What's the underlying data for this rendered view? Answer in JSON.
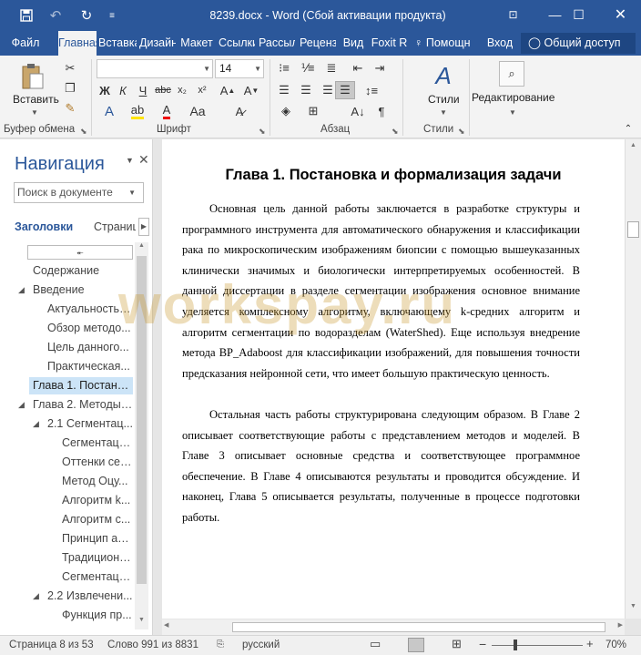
{
  "titlebar": {
    "title": "8239.docx - Word (Сбой активации продукта)",
    "icons": [
      "save-icon",
      "undo-icon",
      "redo-icon",
      "customize-icon"
    ],
    "window_buttons": [
      "ribbon-display-icon",
      "minimize-icon",
      "maximize-icon",
      "close-icon"
    ]
  },
  "tabs": {
    "items": [
      "Файл",
      "Главная",
      "Вставка",
      "Дизайн",
      "Макет",
      "Ссылки",
      "Рассылки",
      "Рецензирование",
      "Вид",
      "Foxit R"
    ],
    "tell_me": "Помощн",
    "signin": "Вход",
    "share": "Общий доступ"
  },
  "ribbon": {
    "paste_label": "Вставить",
    "font_name": "",
    "font_size": "14",
    "bold": "Ж",
    "italic": "К",
    "underline": "Ч",
    "styles_label": "Стили",
    "editing_label": "Редактирование",
    "groups": {
      "clipboard": "Буфер обмена",
      "font": "Шрифт",
      "paragraph": "Абзац",
      "styles": "Стили"
    }
  },
  "nav": {
    "title": "Навигация",
    "search_placeholder": "Поиск в документе",
    "tab_headings": "Заголовки",
    "tab_pages": "Страниц",
    "items": [
      {
        "label": "Содержание",
        "level": 0,
        "toggle": ""
      },
      {
        "label": "Введение",
        "level": 0,
        "toggle": "◢"
      },
      {
        "label": "Актуальность т...",
        "level": 1,
        "toggle": ""
      },
      {
        "label": "Обзор методо...",
        "level": 1,
        "toggle": ""
      },
      {
        "label": "Цель данного...",
        "level": 1,
        "toggle": ""
      },
      {
        "label": "Практическая...",
        "level": 1,
        "toggle": ""
      },
      {
        "label": "Глава 1. Постанов...",
        "level": 0,
        "toggle": "",
        "selected": true
      },
      {
        "label": "Глава 2. Методы а...",
        "level": 0,
        "toggle": "◢"
      },
      {
        "label": "2.1 Сегментац...",
        "level": 1,
        "toggle": "◢"
      },
      {
        "label": "Сегментаци...",
        "level": 2,
        "toggle": ""
      },
      {
        "label": "Оттенки сер...",
        "level": 2,
        "toggle": ""
      },
      {
        "label": "Метод Оцу...",
        "level": 2,
        "toggle": ""
      },
      {
        "label": "Алгоритм k...",
        "level": 2,
        "toggle": ""
      },
      {
        "label": "Алгоритм с...",
        "level": 2,
        "toggle": ""
      },
      {
        "label": "Принцип ал...",
        "level": 2,
        "toggle": ""
      },
      {
        "label": "Традиционн...",
        "level": 2,
        "toggle": ""
      },
      {
        "label": "Сегментаци...",
        "level": 2,
        "toggle": ""
      },
      {
        "label": "2.2 Извлечени...",
        "level": 1,
        "toggle": "◢"
      },
      {
        "label": "Функция пр...",
        "level": 2,
        "toggle": ""
      }
    ]
  },
  "document": {
    "heading": "Глава 1. Постановка и формализация задачи",
    "paragraphs": [
      "Основная цель данной работы заключается в разработке структуры и программного инструмента для автоматического обнаружения и классификации рака по микроскопическим изображениям биопсии с помощью вышеуказанных клинически значимых и биологически интерпретируемых особенностей. В данной диссертации в разделе сегментации изображения основное внимание уделяется комплексному алгоритму, включающему k-средних алгоритм и алгоритм сегментации по водоразделам (WaterShed). Еще используя внедрение метода BP_Adaboost для классификации изображений, для повышения точности предсказания нейронной сети, что имеет большую практическую ценность.",
      "Остальная часть работы структурирована следующим образом. В Главе 2 описывает соответствующие работы с представлением методов и моделей. В Главе 3 описывает основные средства и соответствующее программное обеспечение. В Главе 4 описываются результаты и проводится обсуждение. И наконец, Глава 5 описывается результаты, полученные в процессе подготовки работы."
    ]
  },
  "watermark": "workspay.ru",
  "status": {
    "page": "Страница 8 из 53",
    "words": "Слово 991 из 8831",
    "language": "русский",
    "zoom": "70%"
  },
  "colors": {
    "accent": "#2b579a",
    "selected_nav": "#cce4f7"
  }
}
